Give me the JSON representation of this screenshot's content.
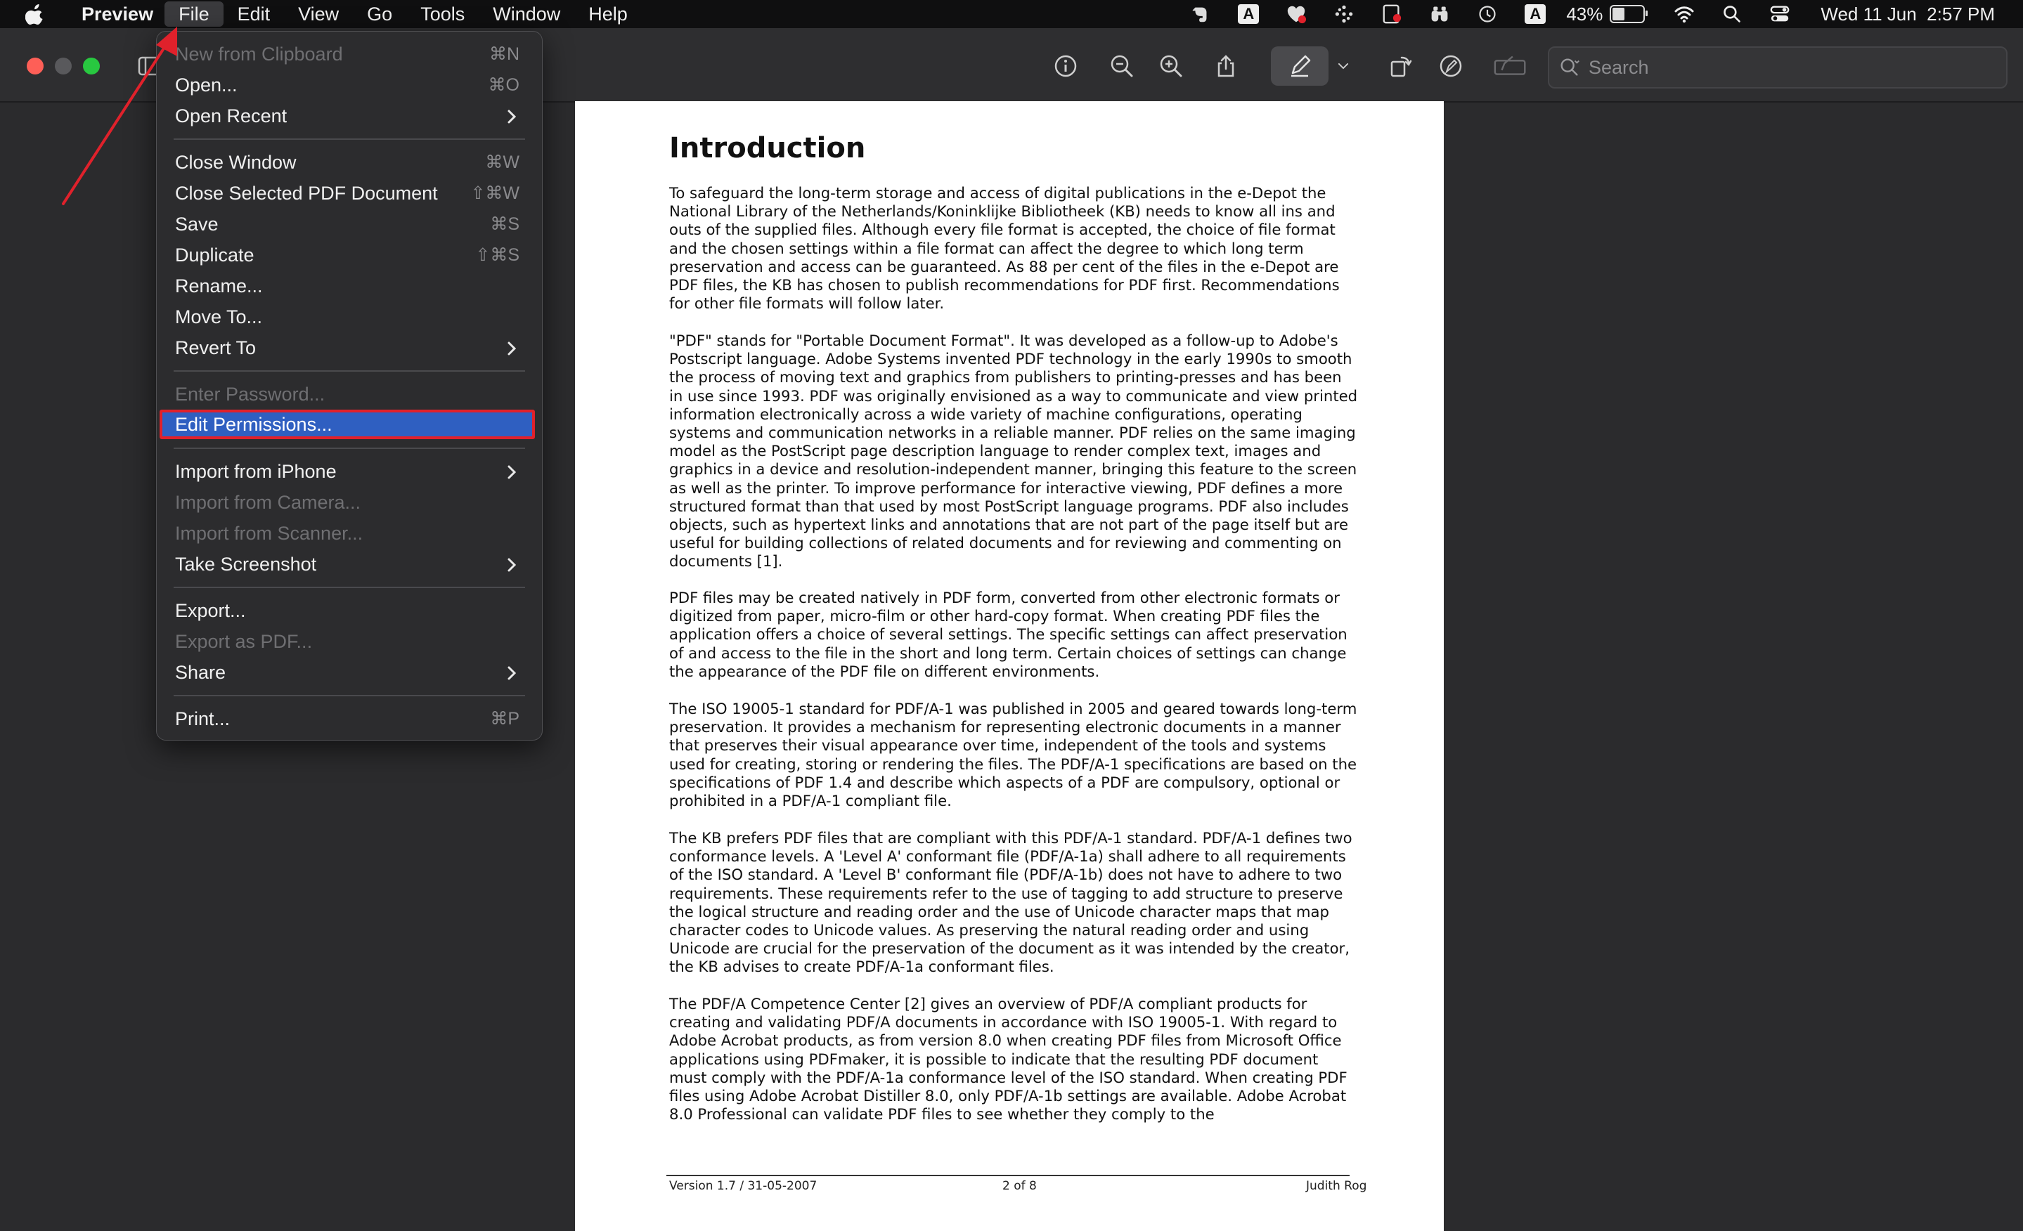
{
  "menubar": {
    "app_name": "Preview",
    "menus": [
      "File",
      "Edit",
      "View",
      "Go",
      "Tools",
      "Window",
      "Help"
    ],
    "battery_percent": "43%",
    "battery_level": 0.43,
    "clock": "Wed 11 Jun  2:57 PM",
    "input_source": "A"
  },
  "toolbar": {
    "search_placeholder": "Search"
  },
  "file_menu": {
    "items": [
      {
        "label": "New from Clipboard",
        "shortcut": "⌘N",
        "disabled": true
      },
      {
        "label": "Open...",
        "shortcut": "⌘O"
      },
      {
        "label": "Open Recent",
        "submenu": true
      },
      {
        "label": "Close Window",
        "shortcut": "⌘W"
      },
      {
        "label": "Close Selected PDF Document",
        "shortcut": "⇧⌘W"
      },
      {
        "label": "Save",
        "shortcut": "⌘S"
      },
      {
        "label": "Duplicate",
        "shortcut": "⇧⌘S"
      },
      {
        "label": "Rename..."
      },
      {
        "label": "Move To..."
      },
      {
        "label": "Revert To",
        "submenu": true
      },
      {
        "label": "Enter Password...",
        "disabled": true
      },
      {
        "label": "Edit Permissions...",
        "selected": true
      },
      {
        "label": "Import from iPhone",
        "submenu": true
      },
      {
        "label": "Import from Camera...",
        "disabled": true
      },
      {
        "label": "Import from Scanner...",
        "disabled": true
      },
      {
        "label": "Take Screenshot",
        "submenu": true
      },
      {
        "label": "Export..."
      },
      {
        "label": "Export as PDF...",
        "disabled": true
      },
      {
        "label": "Share",
        "submenu": true
      },
      {
        "label": "Print...",
        "shortcut": "⌘P"
      }
    ]
  },
  "document": {
    "heading": "Introduction",
    "paragraphs": [
      "To safeguard the long-term storage and access of digital publications in the e-Depot the National Library of the Netherlands/Koninklijke Bibliotheek (KB) needs to know all ins and outs of the supplied files. Although every file format is accepted, the choice of file format and the chosen settings within a file format can affect the degree to which long term preservation and access can be guaranteed. As 88 per cent of the files in the e-Depot are PDF files, the KB has chosen to publish recommendations for PDF first. Recommendations for other file formats will follow later.",
      "\"PDF\" stands for \"Portable Document Format\". It was developed as a follow-up to Adobe's Postscript language. Adobe Systems invented PDF technology in the early 1990s to smooth the process of moving text and graphics from publishers to printing-presses and has been in use since 1993. PDF was originally envisioned as a way to communicate and view printed information electronically across a wide variety of machine configurations, operating systems and communication networks in a reliable manner. PDF relies on the same imaging model as the PostScript page description language to render complex text, images and graphics in a device and resolution-independent manner, bringing this feature to the screen as well as the printer. To improve performance for interactive viewing, PDF defines a more structured format than that used by most PostScript language programs. PDF also includes objects, such as hypertext links and annotations that are not part of the page itself but are useful for building collections of related documents and for reviewing and commenting on documents [1].",
      "PDF files may be created natively in PDF form, converted from other electronic formats or digitized from paper, micro-film or other hard-copy format. When creating PDF files the application offers a choice of several settings. The specific settings can affect preservation of and access to the file in the short and long term. Certain choices of settings can change the appearance of the PDF file on different environments.",
      "The ISO 19005-1 standard for PDF/A-1 was published in 2005 and geared towards long-term preservation. It provides a mechanism for representing electronic documents in a manner that preserves their visual appearance over time, independent of the tools and systems used for creating, storing or rendering the files. The PDF/A-1 specifications are based on the specifications of PDF 1.4 and describe which aspects of a PDF are compulsory, optional or prohibited in a PDF/A-1 compliant file.",
      "The KB prefers PDF files that are compliant with this PDF/A-1 standard. PDF/A-1 defines two conformance levels. A 'Level A' conformant file (PDF/A-1a) shall adhere to all requirements of the ISO standard. A 'Level B' conformant file (PDF/A-1b) does not have to adhere to two requirements. These requirements refer to the use of tagging to add structure to preserve the logical structure and reading order and the use of Unicode character maps that map character codes to Unicode values. As preserving the natural reading order and using Unicode are crucial for the preservation of the document as it was intended by the creator, the KB advises to create PDF/A-1a conformant files.",
      "The PDF/A Competence Center [2] gives an overview of PDF/A compliant products for creating and validating PDF/A documents in accordance with ISO 19005-1. With regard to Adobe Acrobat products, as from version 8.0 when creating PDF files from Microsoft Office applications using PDFmaker, it is possible to indicate that the resulting PDF document must comply with the PDF/A-1a conformance level of the ISO standard. When creating PDF files using Adobe Acrobat Distiller 8.0, only PDF/A-1b settings are available. Adobe Acrobat 8.0 Professional can validate PDF files to see whether they comply to the"
    ],
    "footer": {
      "version": "Version 1.7 / 31-05-2007",
      "page": "2 of 8",
      "author": "Judith Rog"
    }
  },
  "colors": {
    "selection": "#2f5fc1",
    "highlight_border": "#e0212b",
    "arrow": "#e0212b"
  }
}
